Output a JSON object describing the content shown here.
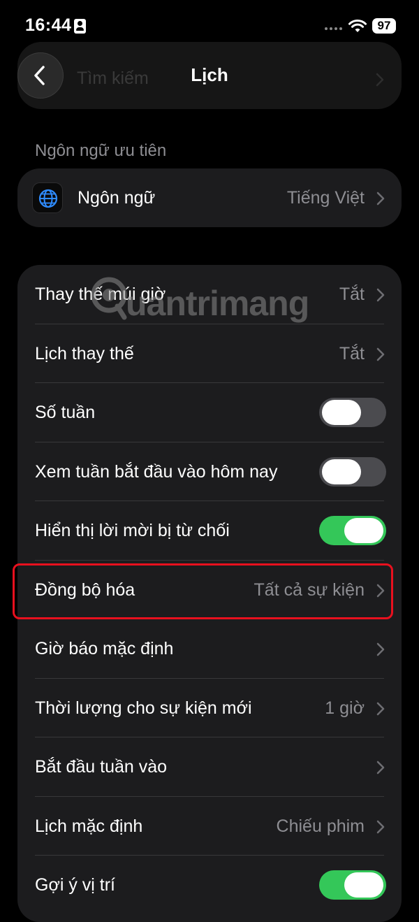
{
  "status_bar": {
    "time": "16:44",
    "battery": "97",
    "icons": [
      "id-card-icon",
      "signal-dots-icon",
      "wifi-icon",
      "battery-icon"
    ]
  },
  "background": {
    "ghost_text": "Tìm kiếm"
  },
  "nav": {
    "title": "Lịch",
    "back_icon": "chevron-left-icon"
  },
  "language_section": {
    "header": "Ngôn ngữ ưu tiên",
    "row": {
      "icon": "globe-icon",
      "label": "Ngôn ngữ",
      "value": "Tiếng Việt"
    }
  },
  "settings": {
    "rows": [
      {
        "label": "Thay thế múi giờ",
        "type": "link",
        "value": "Tắt"
      },
      {
        "label": "Lịch thay thế",
        "type": "link",
        "value": "Tắt"
      },
      {
        "label": "Số tuần",
        "type": "toggle",
        "on": false
      },
      {
        "label": "Xem tuần bắt đầu vào hôm nay",
        "type": "toggle",
        "on": false
      },
      {
        "label": "Hiển thị lời mời bị từ chối",
        "type": "toggle",
        "on": true
      },
      {
        "label": "Đồng bộ hóa",
        "type": "link",
        "value": "Tất cả sự kiện",
        "highlighted": true
      },
      {
        "label": "Giờ báo mặc định",
        "type": "link",
        "value": ""
      },
      {
        "label": "Thời lượng cho sự kiện mới",
        "type": "link",
        "value": "1 giờ"
      },
      {
        "label": "Bắt đầu tuần vào",
        "type": "link",
        "value": ""
      },
      {
        "label": "Lịch mặc định",
        "type": "link",
        "value": "Chiếu phim"
      },
      {
        "label": "Gợi ý vị trí",
        "type": "toggle",
        "on": true
      }
    ]
  },
  "watermark": {
    "text": "uantrimang"
  },
  "colors": {
    "background": "#000000",
    "group_background": "#1c1c1e",
    "secondary_text": "#8e8e93",
    "toggle_on": "#34c759",
    "toggle_off": "#4b4b4f",
    "highlight_border": "#e8101e"
  }
}
